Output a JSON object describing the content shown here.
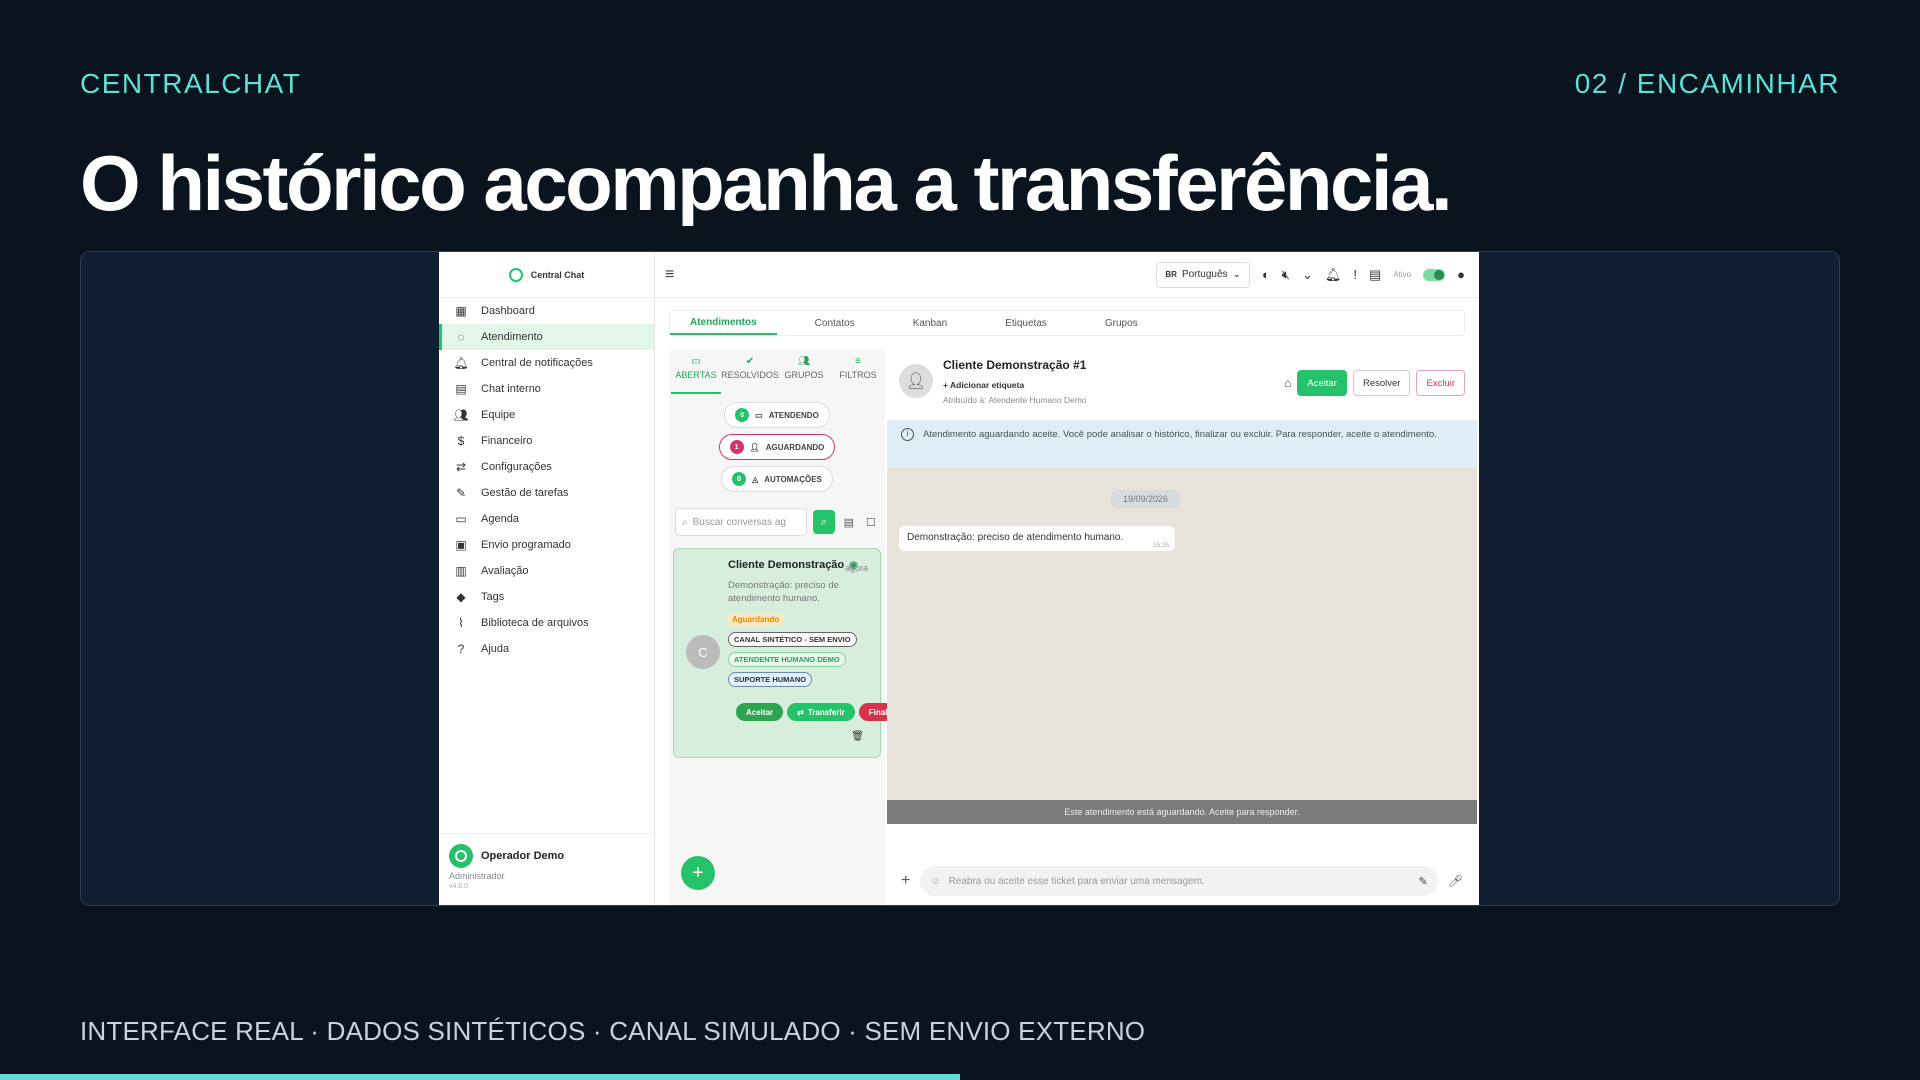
{
  "slide": {
    "brand": "CENTRALCHAT",
    "step": "02 / ENCAMINHAR",
    "headline": "O histórico acompanha a transferência.",
    "footer": "INTERFACE REAL · DADOS SINTÉTICOS · CANAL SIMULADO · SEM ENVIO EXTERNO",
    "progress_fraction": 0.5,
    "accent_color": "#5ee0d6"
  },
  "app": {
    "logo_text": "Central Chat",
    "language": "Português",
    "language_code": "BR",
    "status_label": "Ativo",
    "sidebar": {
      "items": [
        {
          "label": "Dashboard",
          "icon": "dashboard-icon"
        },
        {
          "label": "Atendimento",
          "icon": "whatsapp-icon"
        },
        {
          "label": "Central de notificações",
          "icon": "bell-icon"
        },
        {
          "label": "Chat interno",
          "icon": "chat-icon"
        },
        {
          "label": "Equipe",
          "icon": "team-icon"
        },
        {
          "label": "Financeiro",
          "icon": "money-icon"
        },
        {
          "label": "Configurações",
          "icon": "swap-icon"
        },
        {
          "label": "Gestão de tarefas",
          "icon": "pencil-icon"
        },
        {
          "label": "Agenda",
          "icon": "calendar-icon"
        },
        {
          "label": "Envio programado",
          "icon": "calendar-clock-icon"
        },
        {
          "label": "Avaliação",
          "icon": "chart-icon"
        },
        {
          "label": "Tags",
          "icon": "tag-icon"
        },
        {
          "label": "Biblioteca de arquivos",
          "icon": "paperclip-icon"
        },
        {
          "label": "Ajuda",
          "icon": "help-icon"
        }
      ],
      "active_index": 1
    },
    "operator": {
      "name": "Operador Demo",
      "role": "Administrador",
      "version": "v4.0.0"
    },
    "tabs": [
      "Atendimentos",
      "Contatos",
      "Kanban",
      "Etiquetas",
      "Grupos"
    ],
    "subtabs": [
      "ABERTAS",
      "RESOLVIDOS",
      "GRUPOS",
      "FILTROS"
    ],
    "pills": {
      "atendendo": {
        "count": "0",
        "label": "ATENDENDO"
      },
      "aguardando": {
        "count": "1",
        "label": "AGUARDANDO"
      },
      "automacoes": {
        "count": "0",
        "label": "AUTOMAÇÕES"
      }
    },
    "search_placeholder": "Buscar conversas ag",
    "ticket_card": {
      "avatar_letter": "C",
      "name": "Cliente Demonstração",
      "time": "agora",
      "message": "Demonstração: preciso de atendimento humano.",
      "status": "Aguardando",
      "tags": [
        "CANAL SINTÉTICO - SEM ENVIO",
        "ATENDENTE HUMANO DEMO",
        "SUPORTE HUMANO"
      ],
      "actions": {
        "accept": "Aceitar",
        "transfer": "Transferir",
        "finish": "Finalizar"
      }
    },
    "chat": {
      "contact_name": "Cliente Demonstração #1",
      "add_tag": "Adicionar etiqueta",
      "assigned": "Atribuído à: Atendente Humano Demo",
      "buttons": {
        "accept": "Aceitar",
        "resolve": "Resolver",
        "delete": "Excluir"
      },
      "info": "Atendimento aguardando aceite. Você pode analisar o histórico, finalizar ou excluir. Para responder, aceite o atendimento.",
      "date_chip": "19/09/2026",
      "message": "Demonstração: preciso de atendimento humano.",
      "message_time": "15:35",
      "waiting_banner": "Este atendimento está aguardando. Aceite para responder.",
      "composer_placeholder": "Reabra ou aceite esse ticket para enviar uma mensagem."
    }
  }
}
